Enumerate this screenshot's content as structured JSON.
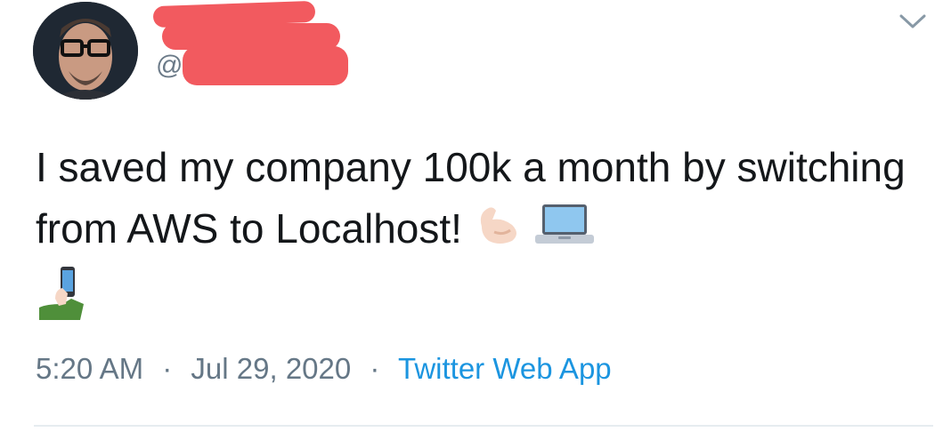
{
  "tweet": {
    "author": {
      "display_name": "",
      "handle_prefix": "@",
      "avatar": "avatar-photo"
    },
    "text": "I saved my company 100k a month by switching from AWS to Localhost!",
    "emojis": [
      "flexed-biceps-icon",
      "laptop-icon",
      "selfie-phone-icon"
    ],
    "time": "5:20 AM",
    "date": "Jul 29, 2020",
    "separator": "·",
    "source": "Twitter Web App"
  },
  "colors": {
    "text": "#14171a",
    "meta": "#657786",
    "link": "#1b95e0",
    "redaction": "#f25a5f",
    "divider": "#e6ecf0"
  }
}
